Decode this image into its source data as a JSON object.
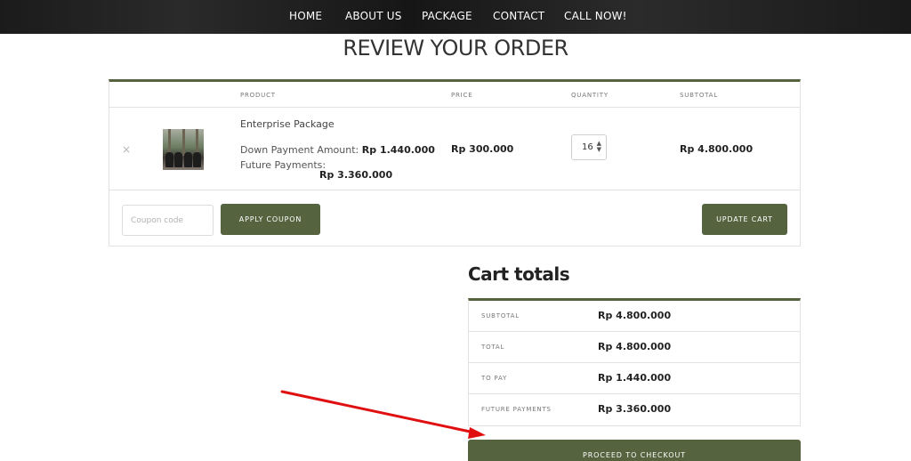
{
  "nav": {
    "items": [
      "HOME",
      "ABOUT US",
      "PACKAGE",
      "CONTACT",
      "CALL NOW!"
    ]
  },
  "page": {
    "title": "REVIEW YOUR ORDER"
  },
  "cart": {
    "headers": [
      "PRODUCT",
      "PRICE",
      "QUANTITY",
      "SUBTOTAL"
    ],
    "item": {
      "remove": "×",
      "name": "Enterprise Package",
      "down_payment_label": "Down Payment Amount:",
      "down_payment_value": "Rp 1.440.000",
      "future_payments_label": "Future Payments:",
      "future_payments_value": "Rp 3.360.000",
      "price": "Rp 300.000",
      "quantity": "16",
      "subtotal": "Rp 4.800.000"
    },
    "coupon_placeholder": "Coupon code",
    "apply_coupon_label": "APPLY COUPON",
    "update_cart_label": "UPDATE CART"
  },
  "totals": {
    "title": "Cart totals",
    "rows": [
      {
        "label": "SUBTOTAL",
        "value": "Rp 4.800.000"
      },
      {
        "label": "TOTAL",
        "value": "Rp 4.800.000"
      },
      {
        "label": "TO PAY",
        "value": "Rp 1.440.000"
      },
      {
        "label": "FUTURE PAYMENTS",
        "value": "Rp 3.360.000"
      }
    ],
    "checkout_label": "PROCEED TO CHECKOUT"
  },
  "colors": {
    "accent": "#55633f",
    "nav_background": "#1f1f1f",
    "annotation_arrow": "#e01010"
  },
  "icons": {
    "remove": "close-icon",
    "quantity_spinner": "chevron-updown-icon",
    "annotation": "arrow-icon"
  }
}
